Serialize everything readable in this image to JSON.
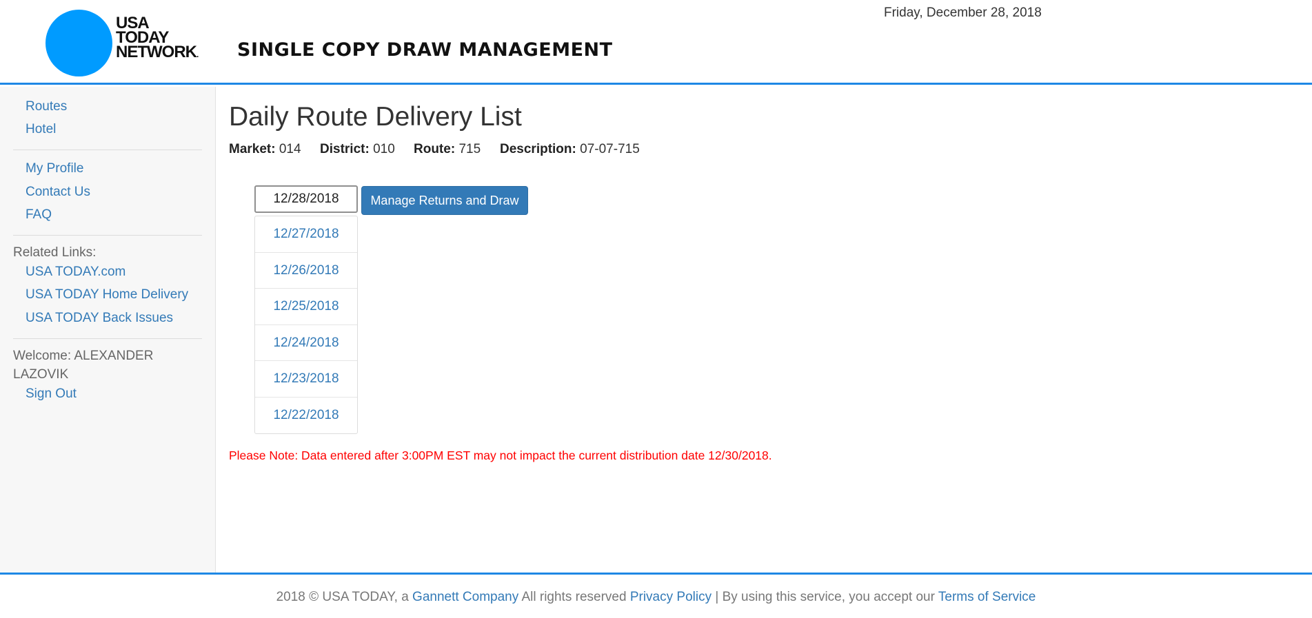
{
  "header": {
    "logo_lines": [
      "USA",
      "TODAY",
      "NETWORK"
    ],
    "logo_mark": ".",
    "app_title": "SINGLE COPY DRAW MANAGEMENT",
    "date": "Friday, December 28, 2018",
    "logo_color": "#009bff",
    "accent_color": "#1e88e5"
  },
  "sidebar": {
    "nav": [
      "Routes",
      "Hotel"
    ],
    "account": [
      "My Profile",
      "Contact Us",
      "FAQ"
    ],
    "related_label": "Related Links:",
    "related": [
      "USA TODAY.com",
      "USA TODAY Home Delivery",
      "USA TODAY Back Issues"
    ],
    "welcome_line1": "Welcome: ALEXANDER",
    "welcome_line2": "LAZOVIK",
    "sign_out": "Sign Out"
  },
  "main": {
    "title": "Daily Route Delivery List",
    "market_label": "Market:",
    "market_value": "014",
    "district_label": "District:",
    "district_value": "010",
    "route_label": "Route:",
    "route_value": "715",
    "description_label": "Description:",
    "description_value": "07-07-715",
    "date_input_value": "12/28/2018",
    "manage_button": "Manage Returns and Draw",
    "date_options": [
      "12/27/2018",
      "12/26/2018",
      "12/25/2018",
      "12/24/2018",
      "12/23/2018",
      "12/22/2018"
    ],
    "note": "Please Note: Data entered after 3:00PM EST may not impact the current distribution date 12/30/2018.",
    "note_color": "#ff0000",
    "link_color": "#337ab7",
    "button_color": "#337ab7"
  },
  "footer": {
    "prefix": "2018 © USA TODAY, a",
    "gannett_link": "Gannett Company",
    "rights": "All rights reserved",
    "privacy_link": "Privacy Policy",
    "separator_text": "| By using this service, you accept our",
    "terms_link": "Terms of Service"
  }
}
